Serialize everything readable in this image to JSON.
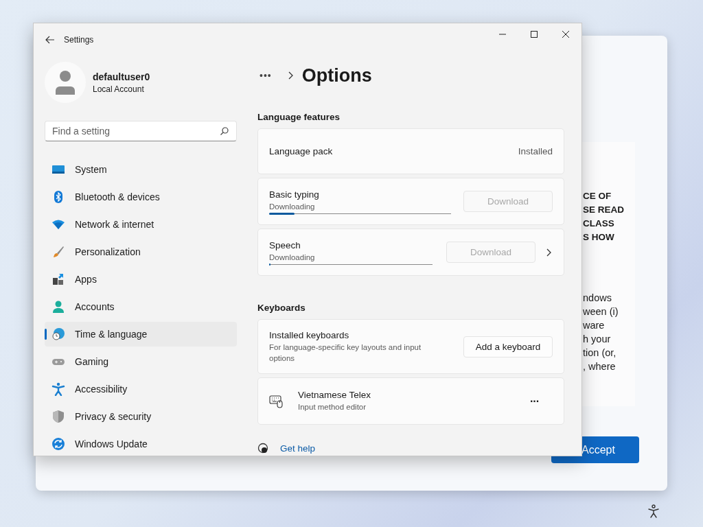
{
  "background_dialog": {
    "text_lines": [
      {
        "text": "CE OF",
        "bold": true
      },
      {
        "text": "SE READ",
        "bold": true
      },
      {
        "text": "CLASS",
        "bold": true
      },
      {
        "text": "S HOW",
        "bold": true
      },
      {
        "text": "ndows",
        "bold": false
      },
      {
        "text": "ween (i)",
        "bold": false
      },
      {
        "text": "ware",
        "bold": false
      },
      {
        "text": "h your",
        "bold": false
      },
      {
        "text": "tion (or,",
        "bold": false
      },
      {
        "text": ", where",
        "bold": false
      }
    ],
    "accept_button": "Accept"
  },
  "settings_window": {
    "title": "Settings",
    "user": {
      "name": "defaultuser0",
      "account_type": "Local Account"
    },
    "search": {
      "placeholder": "Find a setting"
    },
    "nav_items": [
      {
        "label": "System",
        "selected": false
      },
      {
        "label": "Bluetooth & devices",
        "selected": false
      },
      {
        "label": "Network & internet",
        "selected": false
      },
      {
        "label": "Personalization",
        "selected": false
      },
      {
        "label": "Apps",
        "selected": false
      },
      {
        "label": "Accounts",
        "selected": false
      },
      {
        "label": "Time & language",
        "selected": true
      },
      {
        "label": "Gaming",
        "selected": false
      },
      {
        "label": "Accessibility",
        "selected": false
      },
      {
        "label": "Privacy & security",
        "selected": false
      },
      {
        "label": "Windows Update",
        "selected": false
      }
    ],
    "breadcrumb": {
      "overflow": "•••",
      "title": "Options"
    },
    "sections": [
      {
        "heading": "Language features",
        "cards": [
          {
            "kind": "status",
            "title": "Language pack",
            "status": "Installed"
          },
          {
            "kind": "download",
            "title": "Basic typing",
            "subtitle": "Downloading",
            "level": 0.14,
            "button": {
              "label": "Download",
              "disabled": true
            },
            "chevron": false
          },
          {
            "kind": "download",
            "title": "Speech",
            "subtitle": "Downloading",
            "level": 0.01,
            "button": {
              "label": "Download",
              "disabled": true
            },
            "chevron": true
          }
        ]
      },
      {
        "heading": "Keyboards",
        "cards": [
          {
            "kind": "action",
            "title": "Installed keyboards",
            "subtitle": "For language-specific key layouts and input options",
            "button": {
              "label": "Add a keyboard",
              "disabled": false
            }
          },
          {
            "kind": "keyboard",
            "title": "Vietnamese Telex",
            "subtitle": "Input method editor",
            "more": "···"
          }
        ]
      }
    ],
    "help_link": "Get help"
  }
}
